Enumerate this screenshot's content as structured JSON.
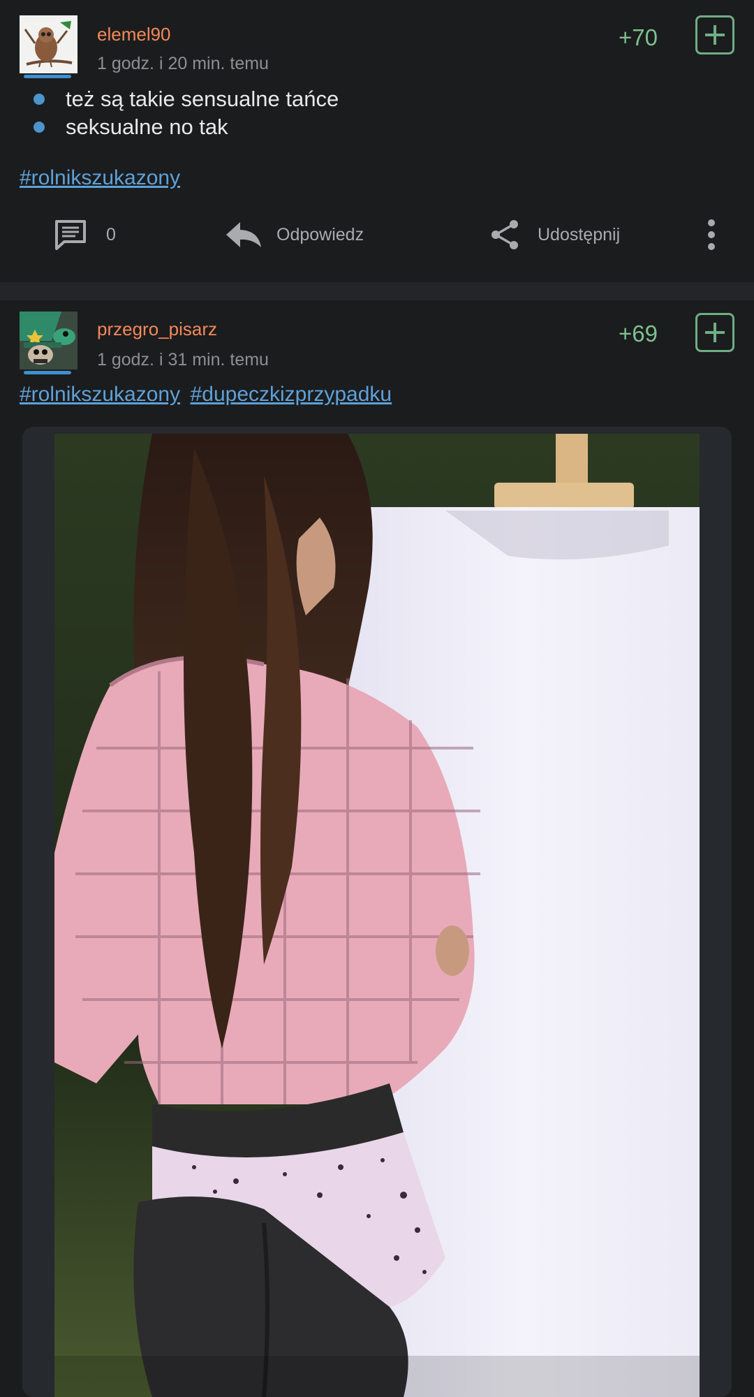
{
  "posts": [
    {
      "username": "elemel90",
      "timestamp": "1 godz. i 20 min. temu",
      "score": "+70",
      "bullets": [
        "też są takie sensualne tańce",
        "seksualne no tak"
      ],
      "hashtags": [
        "#rolnikszukazony"
      ],
      "avatar_icon": "owl-avatar-icon",
      "actions": {
        "comment_count": "0",
        "reply_label": "Odpowiedz",
        "share_label": "Udostępnij"
      }
    },
    {
      "username": "przegro_pisarz",
      "timestamp": "1 godz. i 31 min. temu",
      "score": "+69",
      "hashtags": [
        "#rolnikszukazony",
        "#dupeczkizprzypadku"
      ],
      "avatar_icon": "cartoon-wizard-avatar-icon",
      "media_icon": "photo-of-woman-at-canvas-icon"
    }
  ],
  "colors": {
    "background": "#1b1c1e",
    "username": "#f4895a",
    "score": "#7fbf8f",
    "hashtag": "#5ea1d8",
    "bullet": "#4b94cc"
  }
}
